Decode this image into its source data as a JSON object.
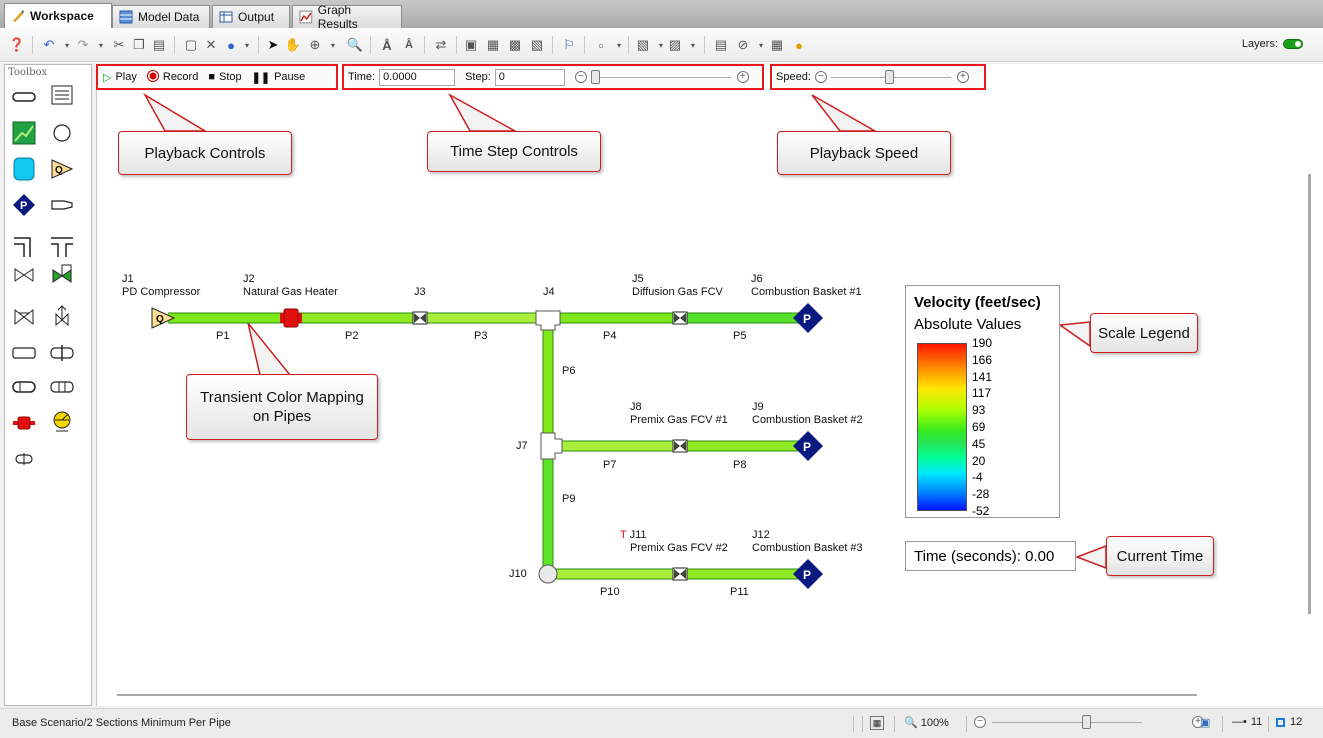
{
  "tabs": [
    {
      "label": "Workspace",
      "icon": "workspace-icon"
    },
    {
      "label": "Model Data",
      "icon": "model-data-icon"
    },
    {
      "label": "Output",
      "icon": "output-icon"
    },
    {
      "label": "Graph Results",
      "icon": "graph-results-icon"
    }
  ],
  "toolbar": {
    "layers_label": "Layers:"
  },
  "toolbox": {
    "title": "Toolbox"
  },
  "playback": {
    "play": "Play",
    "record": "Record",
    "stop": "Stop",
    "pause": "Pause",
    "time_label": "Time:",
    "time_value": "0.0000",
    "step_label": "Step:",
    "step_value": "0",
    "speed_label": "Speed:"
  },
  "callouts": {
    "playback_controls": "Playback Controls",
    "time_step_controls": "Time Step Controls",
    "playback_speed": "Playback Speed",
    "transient_color_line1": "Transient Color Mapping",
    "transient_color_line2": "on Pipes",
    "scale_legend": "Scale Legend",
    "current_time": "Current Time"
  },
  "junctions": {
    "j1": {
      "id": "J1",
      "name": "PD Compressor"
    },
    "j2": {
      "id": "J2",
      "name": "Natural Gas Heater"
    },
    "j3": {
      "id": "J3"
    },
    "j4": {
      "id": "J4"
    },
    "j5": {
      "id": "J5",
      "name": "Diffusion Gas FCV"
    },
    "j6": {
      "id": "J6",
      "name": "Combustion Basket #1"
    },
    "j7": {
      "id": "J7"
    },
    "j8": {
      "id": "J8",
      "name": "Premix Gas FCV #1"
    },
    "j9": {
      "id": "J9",
      "name": "Combustion Basket #2"
    },
    "j10": {
      "id": "J10"
    },
    "j11": {
      "prefix": "T",
      "id": "J11",
      "name": "Premix Gas FCV #2"
    },
    "j12": {
      "id": "J12",
      "name": "Combustion Basket #3"
    }
  },
  "pipes": {
    "p1": "P1",
    "p2": "P2",
    "p3": "P3",
    "p4": "P4",
    "p5": "P5",
    "p6": "P6",
    "p7": "P7",
    "p8": "P8",
    "p9": "P9",
    "p10": "P10",
    "p11": "P11"
  },
  "legend": {
    "title": "Velocity (feet/sec)",
    "subtitle": "Absolute Values",
    "ticks": [
      "190",
      "166",
      "141",
      "117",
      "93",
      "69",
      "45",
      "20",
      "-4",
      "-28",
      "-52"
    ]
  },
  "time_display": "Time (seconds): 0.00",
  "status": {
    "scenario": "Base Scenario/2 Sections Minimum Per Pipe",
    "zoom": "100%",
    "pipe_count": "11",
    "junction_count": "12"
  },
  "colors": {
    "accent_red": "#e8181b",
    "pipe_green": "#7ee81a",
    "pipe_green_light": "#a8ee3a",
    "node_blue": "#0a1a80"
  }
}
